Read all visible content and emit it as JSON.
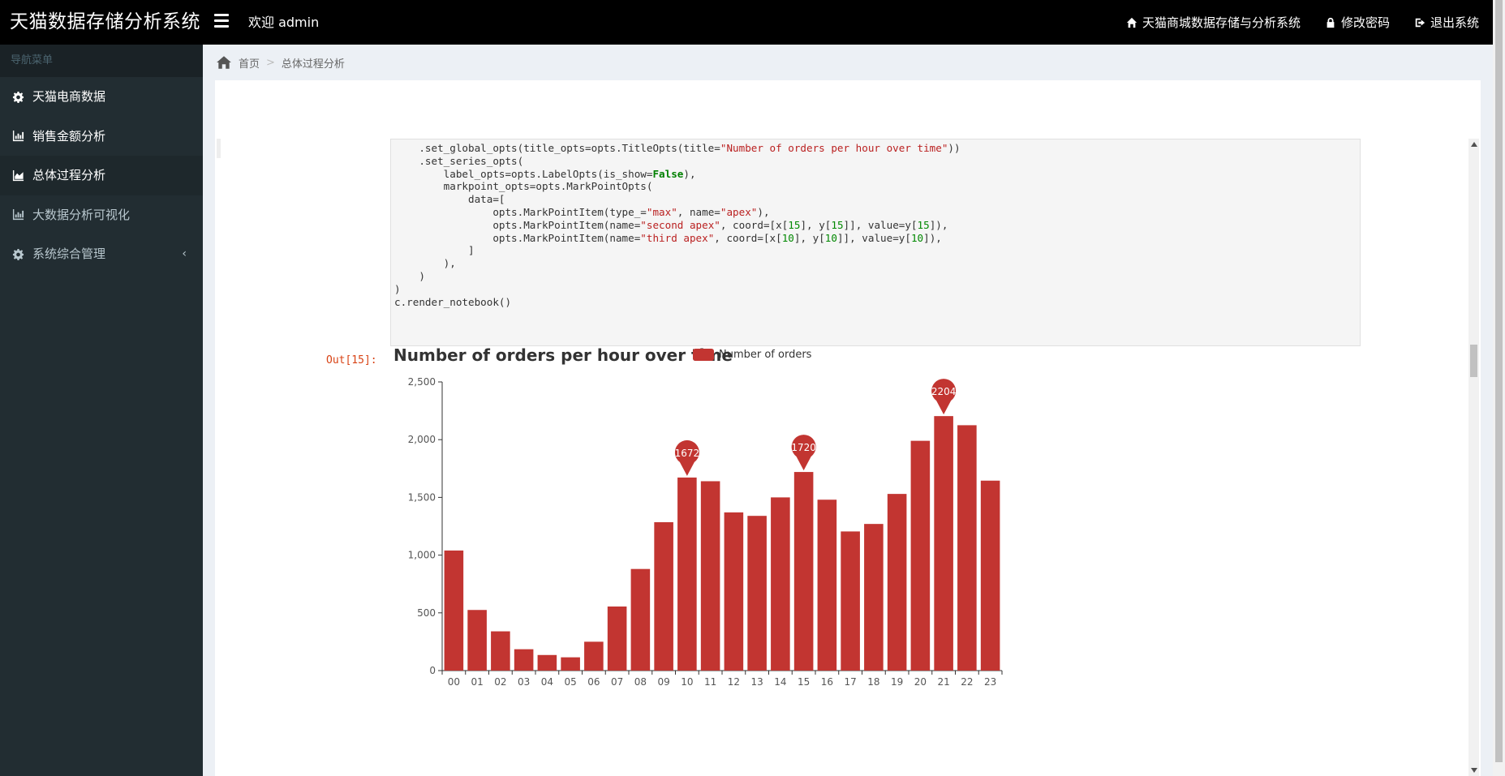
{
  "header": {
    "brand": "天猫数据存储分析系统",
    "welcome": "欢迎 admin",
    "nav": [
      {
        "label": "天猫商城数据存储与分析系统",
        "icon": "home-icon"
      },
      {
        "label": "修改密码",
        "icon": "lock-icon"
      },
      {
        "label": "退出系统",
        "icon": "sign-out-icon"
      }
    ]
  },
  "sidebar": {
    "header": "导航菜单",
    "items": [
      {
        "label": "天猫电商数据",
        "icon": "gear-icon"
      },
      {
        "label": "销售金额分析",
        "icon": "bar-chart-icon"
      },
      {
        "label": "总体过程分析",
        "icon": "area-chart-icon"
      },
      {
        "label": "大数据分析可视化",
        "icon": "bar-chart-icon"
      },
      {
        "label": "系统综合管理",
        "icon": "gear-icon"
      }
    ]
  },
  "breadcrumb": {
    "home": "首页",
    "current": "总体过程分析"
  },
  "notebook": {
    "code_lines": [
      "    .set_global_opts(title_opts=opts.TitleOpts(title=\"Number of orders per hour over time\"))",
      "    .set_series_opts(",
      "        label_opts=opts.LabelOpts(is_show=False),",
      "        markpoint_opts=opts.MarkPointOpts(",
      "            data=[",
      "                opts.MarkPointItem(type_=\"max\", name=\"apex\"),",
      "                opts.MarkPointItem(name=\"second apex\", coord=[x[15], y[15]], value=y[15]),",
      "                opts.MarkPointItem(name=\"third apex\", coord=[x[10], y[10]], value=y[10]),",
      "            ]",
      "        ),",
      "    )",
      ")",
      "c.render_notebook()"
    ],
    "out_prompt": "Out[15]:"
  },
  "chart_data": {
    "type": "bar",
    "title": "Number of orders per hour over time",
    "legend": [
      "Number of orders"
    ],
    "legend_position": "top",
    "categories": [
      "00",
      "01",
      "02",
      "03",
      "04",
      "05",
      "06",
      "07",
      "08",
      "09",
      "10",
      "11",
      "12",
      "13",
      "14",
      "15",
      "16",
      "17",
      "18",
      "19",
      "20",
      "21",
      "22",
      "23"
    ],
    "series": [
      {
        "name": "Number of orders",
        "values": [
          1040,
          525,
          340,
          185,
          135,
          115,
          250,
          555,
          880,
          1285,
          1672,
          1640,
          1370,
          1340,
          1500,
          1720,
          1480,
          1205,
          1270,
          1530,
          1990,
          2204,
          2125,
          1645
        ]
      }
    ],
    "ylim": [
      0,
      2500
    ],
    "yticks": [
      0,
      500,
      1000,
      1500,
      2000,
      2500
    ],
    "ytick_labels": [
      "0",
      "500",
      "1,000",
      "1,500",
      "2,000",
      "2,500"
    ],
    "markpoints": [
      {
        "category": "21",
        "value": 2204,
        "label": "2204"
      },
      {
        "category": "15",
        "value": 1720,
        "label": "1720"
      },
      {
        "category": "10",
        "value": 1672,
        "label": "1672"
      }
    ],
    "color": "#c23531",
    "grid": false
  }
}
